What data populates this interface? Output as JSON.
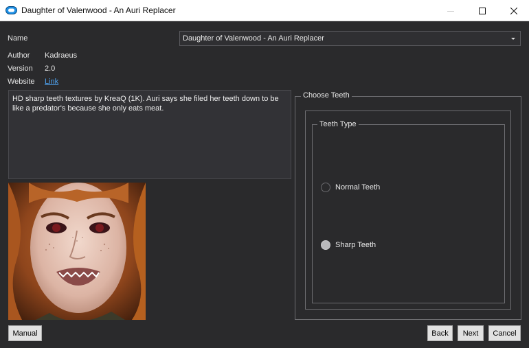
{
  "window": {
    "title": "Daughter of Valenwood - An Auri Replacer"
  },
  "info": {
    "name_label": "Name",
    "name_value": "Daughter of Valenwood - An Auri Replacer",
    "author_label": "Author",
    "author_value": "Kadraeus",
    "version_label": "Version",
    "version_value": "2.0",
    "website_label": "Website",
    "website_value": "Link"
  },
  "description": "HD sharp teeth textures by KreaQ (1K). Auri says she filed her teeth down to be like a predator's because she only eats meat.",
  "options": {
    "outer_group_title": "Choose Teeth",
    "inner_group_title": "Teeth Type",
    "choices": [
      {
        "label": "Normal Teeth",
        "selected": false
      },
      {
        "label": "Sharp Teeth",
        "selected": true
      }
    ]
  },
  "buttons": {
    "manual": "Manual",
    "back": "Back",
    "next": "Next",
    "cancel": "Cancel"
  },
  "colors": {
    "background": "#2a2a2c",
    "link": "#4ea3f1",
    "app_icon": "#1e90e6"
  }
}
